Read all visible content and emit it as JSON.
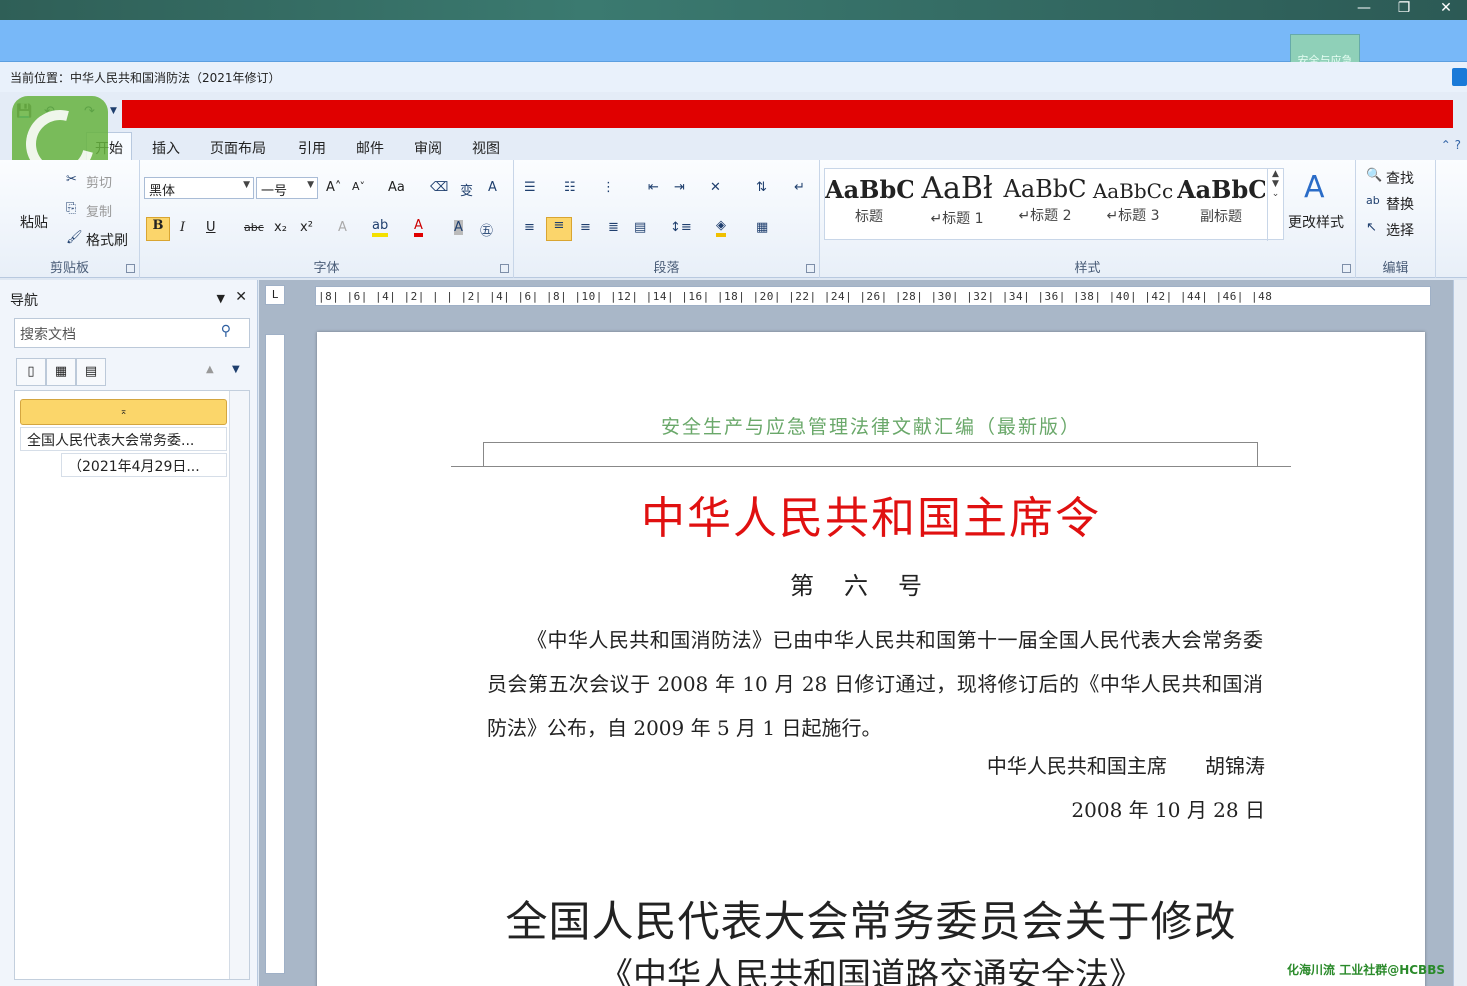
{
  "window": {
    "minimize": "—",
    "maximize": "❐",
    "close": "✕"
  },
  "location": {
    "label": "当前位置：",
    "value": "中华人民共和国消防法（2021年修订）"
  },
  "brand_box": "安全与应急",
  "tabs": [
    {
      "label": "开始",
      "active": true
    },
    {
      "label": "插入"
    },
    {
      "label": "页面布局"
    },
    {
      "label": "引用"
    },
    {
      "label": "邮件"
    },
    {
      "label": "审阅"
    },
    {
      "label": "视图"
    }
  ],
  "ribbon": {
    "clipboard": {
      "label": "剪贴板",
      "paste": "粘贴",
      "cut": "剪切",
      "copy": "复制",
      "format_painter": "格式刷"
    },
    "font": {
      "label": "字体",
      "font_name": "黑体",
      "font_size": "一号",
      "bold": "B",
      "italic": "I",
      "underline": "U",
      "strike": "abc",
      "subscript": "x₂",
      "superscript": "x²",
      "grow": "A˄",
      "shrink": "A˅",
      "case": "Aa",
      "color_a": "A"
    },
    "paragraph": {
      "label": "段落"
    },
    "styles": {
      "label": "样式",
      "items": [
        {
          "sample": "AaBbC",
          "name": "标题"
        },
        {
          "sample": "AaBł",
          "name": "↵标题 1"
        },
        {
          "sample": "AaBbC",
          "name": "↵标题 2"
        },
        {
          "sample": "AaBbCc",
          "name": "↵标题 3"
        },
        {
          "sample": "AaBbC",
          "name": "副标题"
        }
      ],
      "change_styles": "更改样式"
    },
    "editing": {
      "label": "编辑",
      "find": "查找",
      "replace": "替换",
      "select": "选择"
    }
  },
  "nav": {
    "title": "导航",
    "search_placeholder": "搜索文档",
    "head_item": "⌅",
    "items": [
      "全国人民代表大会常务委...",
      "（2021年4月29日..."
    ]
  },
  "ruler": {
    "marks": "|8| |6| |4| |2| | | |2| |4| |6| |8| |10| |12| |14| |16| |18| |20| |22| |24| |26| |28| |30| |32| |34| |36| |38| |40| |42| |44| |46| |48",
    "corner": "L"
  },
  "document": {
    "header": "安全生产与应急管理法律文献汇编（最新版）",
    "title": "中华人民共和国主席令",
    "number": "第六号",
    "paragraph": "《中华人民共和国消防法》已由中华人民共和国第十一届全国人民代表大会常务委员会第五次会议于 2008 年 10 月 28 日修订通过，现将修订后的《中华人民共和国消防法》公布，自 2009 年 5 月 1 日起施行。",
    "signature": "中华人民共和国主席      胡锦涛",
    "date": "2008 年 10 月 28 日",
    "title2": "全国人民代表大会常务委员会关于修改",
    "title3": "《中华人民共和国道路交通安全法》"
  },
  "watermark": "化海川流 工业社群@HCBBS"
}
